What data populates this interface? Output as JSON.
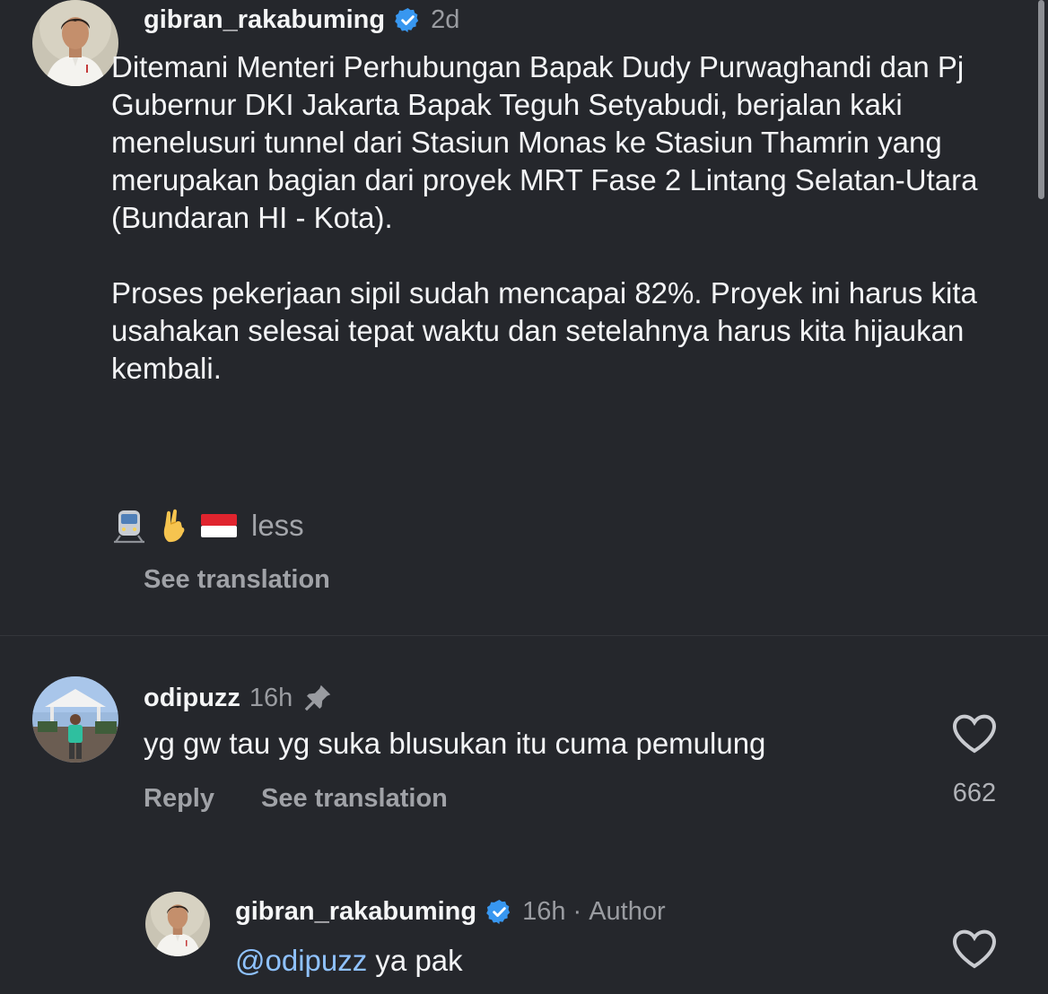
{
  "post": {
    "username": "gibran_rakabuming",
    "time": "2d",
    "paragraph1": "Ditemani Menteri Perhubungan Bapak Dudy Purwaghandi dan Pj Gubernur DKI Jakarta Bapak Teguh Setyabudi, berjalan kaki menelusuri tunnel dari Stasiun Monas ke Stasiun Thamrin yang merupakan bagian dari proyek MRT Fase 2 Lintang Selatan-Utara (Bundaran HI - Kota).",
    "paragraph2": "Proses pekerjaan sipil sudah mencapai 82%. Proyek ini harus kita usahakan selesai tepat waktu dan setelahnya harus kita hijaukan kembali.",
    "emojis": [
      "train-front-emoji",
      "crossed-fingers-emoji",
      "indonesia-flag-emoji"
    ],
    "less_label": "less",
    "see_translation": "See translation"
  },
  "comment": {
    "username": "odipuzz",
    "time": "16h",
    "text": "yg gw tau yg suka blusukan itu cuma pemulung",
    "reply_label": "Reply",
    "see_translation": "See translation",
    "like_count": "662"
  },
  "reply": {
    "username": "gibran_rakabuming",
    "time": "16h",
    "separator": "·",
    "author_label": "Author",
    "mention": "@odipuzz",
    "text": " ya pak"
  },
  "colors": {
    "background": "#25272c",
    "verified_blue": "#3897f0",
    "mention_blue": "#8fc2ff",
    "muted_text": "#a0a2a7"
  }
}
